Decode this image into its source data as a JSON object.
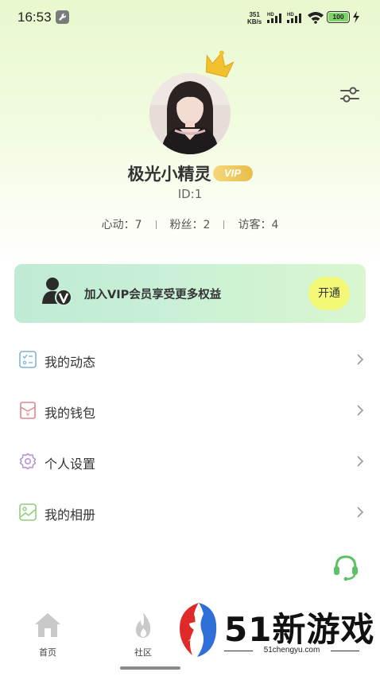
{
  "status_bar": {
    "time": "16:53",
    "net_speed_value": "351",
    "net_speed_unit": "KB/s",
    "signal_1_label": "HD",
    "signal_2_label": "HD",
    "battery": "100"
  },
  "profile": {
    "nickname": "极光小精灵",
    "vip_badge": "VIP",
    "user_id": "ID:1",
    "stats": [
      {
        "label": "心动：7"
      },
      {
        "label": "粉丝：2"
      },
      {
        "label": "访客：4"
      }
    ]
  },
  "vip_card": {
    "text": "加入VIP会员享受更多权益",
    "button": "开通"
  },
  "menu": {
    "items": [
      {
        "label": "我的动态",
        "icon": "moments-icon"
      },
      {
        "label": "我的钱包",
        "icon": "wallet-icon"
      },
      {
        "label": "个人设置",
        "icon": "settings-icon"
      },
      {
        "label": "我的相册",
        "icon": "album-icon"
      }
    ]
  },
  "tabbar": {
    "tabs": [
      {
        "label": "首页",
        "icon": "home-icon"
      },
      {
        "label": "社区",
        "icon": "fire-icon"
      }
    ]
  },
  "watermark": {
    "brand": "51新游戏",
    "url": "51chengyu.com"
  },
  "colors": {
    "accent_yellow": "#f3f876",
    "vip_gold": "#e8bd4a",
    "header_green": "#e9f8cf",
    "vip_card_green": "#c9f0d6"
  }
}
